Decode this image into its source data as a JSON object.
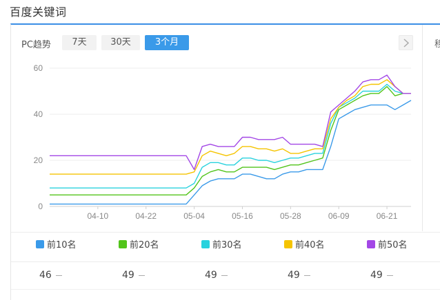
{
  "section": {
    "title": "百度关键词"
  },
  "panel": {
    "platform_label": "PC趋势",
    "ranges": [
      {
        "label": "7天",
        "active": false
      },
      {
        "label": "30天",
        "active": false
      },
      {
        "label": "3个月",
        "active": true
      }
    ],
    "next_icon": "chevron-right-icon",
    "cut_text": "移"
  },
  "chart_data": {
    "type": "line",
    "y_ticks": [
      "0",
      "20",
      "40",
      "60"
    ],
    "ylim": [
      0,
      60
    ],
    "x_ticks": [
      "04-10",
      "04-22",
      "05-04",
      "05-16",
      "05-28",
      "06-09",
      "06-21"
    ],
    "x": [
      "03-29",
      "04-01",
      "04-04",
      "04-07",
      "04-10",
      "04-13",
      "04-16",
      "04-19",
      "04-22",
      "04-25",
      "04-28",
      "05-01",
      "05-02",
      "05-04",
      "05-06",
      "05-08",
      "05-10",
      "05-12",
      "05-14",
      "05-16",
      "05-18",
      "05-20",
      "05-22",
      "05-24",
      "05-26",
      "05-28",
      "05-30",
      "06-01",
      "06-03",
      "06-05",
      "06-07",
      "06-09",
      "06-11",
      "06-13",
      "06-15",
      "06-17",
      "06-19",
      "06-21",
      "06-23",
      "06-25",
      "06-27"
    ],
    "grid": true,
    "series": [
      {
        "name": "前10名",
        "color": "#3a9ae9",
        "values": [
          1,
          1,
          1,
          1,
          1,
          1,
          1,
          1,
          1,
          1,
          1,
          1,
          1,
          5,
          9,
          11,
          12,
          12,
          12,
          14,
          14,
          13,
          12,
          12,
          14,
          15,
          15,
          16,
          16,
          16,
          26,
          38,
          40,
          42,
          43,
          44,
          44,
          44,
          42,
          44,
          46
        ]
      },
      {
        "name": "前20名",
        "color": "#52c41a",
        "values": [
          5,
          5,
          5,
          5,
          5,
          5,
          5,
          5,
          5,
          5,
          5,
          5,
          5,
          8,
          13,
          15,
          16,
          15,
          15,
          17,
          17,
          17,
          17,
          16,
          17,
          18,
          18,
          19,
          20,
          21,
          33,
          42,
          44,
          46,
          48,
          49,
          49,
          52,
          48,
          49,
          49
        ]
      },
      {
        "name": "前30名",
        "color": "#29d2de",
        "values": [
          8,
          8,
          8,
          8,
          8,
          8,
          8,
          8,
          8,
          8,
          8,
          8,
          8,
          10,
          17,
          19,
          19,
          18,
          18,
          21,
          21,
          20,
          20,
          19,
          20,
          21,
          21,
          22,
          23,
          23,
          36,
          43,
          45,
          47,
          50,
          50,
          50,
          53,
          50,
          49,
          49
        ]
      },
      {
        "name": "前40名",
        "color": "#f5c400",
        "values": [
          14,
          14,
          14,
          14,
          14,
          14,
          14,
          14,
          14,
          14,
          14,
          14,
          14,
          15,
          22,
          24,
          23,
          22,
          23,
          26,
          26,
          25,
          25,
          24,
          25,
          23,
          23,
          24,
          25,
          25,
          38,
          43,
          46,
          48,
          52,
          53,
          53,
          55,
          52,
          49,
          49
        ]
      },
      {
        "name": "前50名",
        "color": "#a347e6",
        "values": [
          22,
          22,
          22,
          22,
          22,
          22,
          22,
          22,
          22,
          22,
          22,
          22,
          22,
          16,
          26,
          27,
          26,
          26,
          26,
          30,
          30,
          29,
          29,
          29,
          30,
          27,
          27,
          27,
          27,
          26,
          41,
          44,
          47,
          50,
          54,
          55,
          55,
          57,
          52,
          49,
          49
        ]
      }
    ]
  },
  "values_row": [
    {
      "value": "46"
    },
    {
      "value": "49"
    },
    {
      "value": "49"
    },
    {
      "value": "49"
    },
    {
      "value": "49"
    }
  ]
}
